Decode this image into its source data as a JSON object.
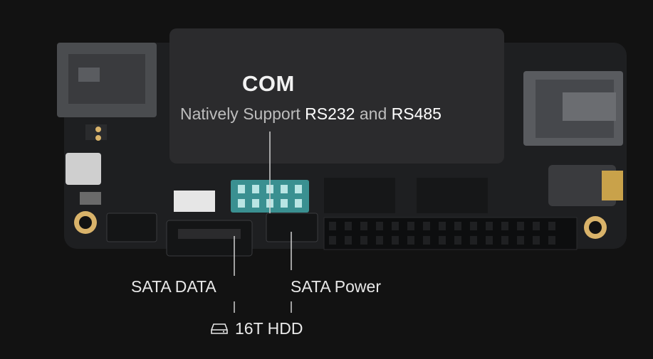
{
  "callouts": {
    "com_title": "COM",
    "com_subtitle_a": "Natively Support ",
    "com_subtitle_b": "RS232",
    "com_subtitle_c": " and ",
    "com_subtitle_d": "RS485",
    "sata_data": "SATA DATA",
    "sata_power": "SATA Power",
    "hdd": "16T HDD"
  },
  "icons": {
    "hdd": "hard-drive-icon"
  },
  "colors": {
    "background": "#121212",
    "board": "#1e1f21",
    "heatsink": "#2b2b2d",
    "com_header_highlight": "#3fa5a4",
    "mount_hole_ring": "#d9b36a",
    "text": "#e8e8e8"
  }
}
